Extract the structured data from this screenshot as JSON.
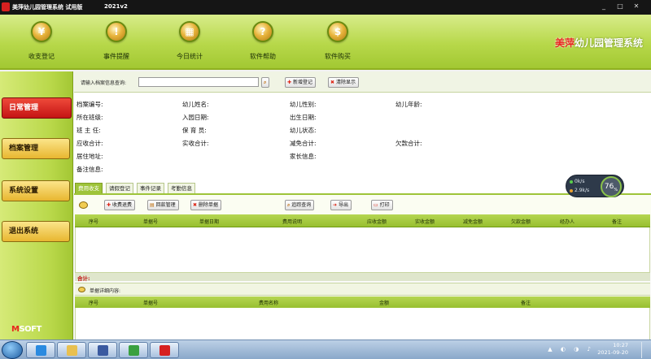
{
  "window": {
    "title": "美萍幼儿园管理系统 试用版",
    "version": "2021v2",
    "controls": [
      "_",
      "□",
      "✕"
    ]
  },
  "toolbar": {
    "items": [
      {
        "label": "收支登记",
        "icon": "ledger-icon"
      },
      {
        "label": "事件提醒",
        "icon": "bell-icon"
      },
      {
        "label": "今日统计",
        "icon": "calendar-icon"
      },
      {
        "label": "软件帮助",
        "icon": "help-icon"
      },
      {
        "label": "软件购买",
        "icon": "cart-icon"
      }
    ],
    "brand_red": "美萍",
    "brand_rest": "幼儿园管理系统"
  },
  "nav": {
    "items": [
      {
        "label": "日常管理",
        "active": true
      },
      {
        "label": "档案管理",
        "active": false
      },
      {
        "label": "系统设置",
        "active": false
      },
      {
        "label": "退出系统",
        "active": false
      }
    ],
    "logo_m": "M",
    "logo_rest": "SOFT"
  },
  "search": {
    "label": "请输入档案信息查询:",
    "placeholder": "",
    "value": "",
    "add_label": "新增登记",
    "clear_label": "清除显示"
  },
  "fields": {
    "record_no": "档案编号:",
    "child_name": "幼儿姓名:",
    "child_gender": "幼儿性别:",
    "child_age": "幼儿年龄:",
    "class_name": "所在班级:",
    "enroll_date": "入园日期:",
    "birth_date": "出生日期:",
    "head_teacher": "班 主 任:",
    "nurse": "保 育 员:",
    "child_status": "幼儿状态:",
    "receivable_total": "应收合计:",
    "received_total": "实收合计:",
    "discount_total": "减免合计:",
    "owed_total": "欠款合计:",
    "address": "居住地址:",
    "parent_info": "家长信息:",
    "notes": "备注信息:"
  },
  "tabs": [
    {
      "label": "费用收支",
      "active": true
    },
    {
      "label": "请假登记",
      "active": false
    },
    {
      "label": "事件记录",
      "active": false
    },
    {
      "label": "考勤信息",
      "active": false
    }
  ],
  "actions": {
    "collect": "收费退费",
    "receipt": "回款管理",
    "delete": "删除单据",
    "query": "追踪查询",
    "export": "导出",
    "print": "打印"
  },
  "grid": {
    "columns": [
      "序号",
      "单据号",
      "单据日期",
      "费用说明",
      "应收金额",
      "实收金额",
      "减免金额",
      "欠款金额",
      "经办人",
      "备注"
    ],
    "rows": []
  },
  "total_label": "合计:",
  "detail": {
    "title": "单据详细内容:",
    "columns": [
      "序号",
      "单据号",
      "费用名称",
      "金额",
      "备注"
    ]
  },
  "widget": {
    "up": "0k/s",
    "down": "2.9k/s",
    "percent": "76",
    "unit": "%"
  },
  "taskbar": {
    "time": "10:27",
    "date": "2021-09-20"
  },
  "colors": {
    "theme_green": "#a2c832",
    "nav_active_red": "#c41414",
    "brand_red": "#e8261e"
  }
}
